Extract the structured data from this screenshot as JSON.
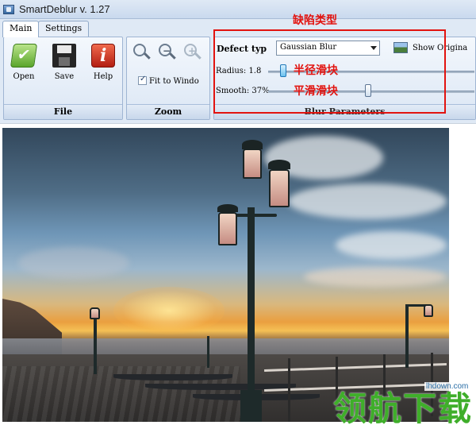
{
  "window": {
    "title": "SmartDeblur v. 1.27"
  },
  "tabs": [
    {
      "label": "Main"
    },
    {
      "label": "Settings"
    }
  ],
  "file_group": {
    "label": "File",
    "buttons": [
      {
        "label": "Open",
        "icon": "open-icon"
      },
      {
        "label": "Save",
        "icon": "save-icon"
      },
      {
        "label": "Help",
        "icon": "help-icon"
      }
    ]
  },
  "zoom_group": {
    "label": "Zoom",
    "icons": [
      "zoom-icon",
      "zoom-out-icon",
      "zoom-in-icon"
    ],
    "fit_to_window": {
      "label": "Fit to Windo",
      "checked": true
    }
  },
  "blur_group": {
    "label": "Blur Parameters",
    "defect_type": {
      "label": "Defect typ",
      "value": "Gaussian Blur"
    },
    "show_original": {
      "label": "Show Origina"
    },
    "radius": {
      "label": "Radius: 1.8",
      "value": 1.8
    },
    "smooth": {
      "label": "Smooth: 37%",
      "value": 37
    }
  },
  "annotations": {
    "defect_type": "缺陷类型",
    "radius_slider": "半径滑块",
    "smooth_slider": "平滑滑块",
    "color": "#e2130f"
  },
  "watermark": {
    "text": "领航下载",
    "url": "lhdown.com",
    "color": "#3fae2a"
  }
}
